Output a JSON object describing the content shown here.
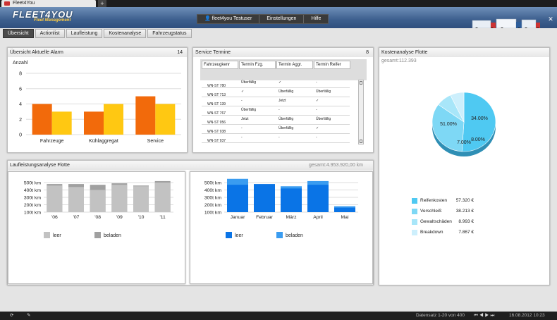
{
  "browser": {
    "tab_title": "Fleet4You",
    "new_tab": "+"
  },
  "header": {
    "logo_main": "FLEET4YOU",
    "logo_sub": "Fleet Management",
    "nav": [
      "fleet4you Testuser",
      "Einstellungen",
      "Hilfe"
    ],
    "close": "✕"
  },
  "tabs": [
    "Übersicht",
    "Actionlist",
    "Laufleistung",
    "Kostenanalyse",
    "Fahrzeugstatus"
  ],
  "alarm": {
    "title": "Übersicht Aktuelle Alarm",
    "count": "14",
    "ylabel": "Anzahl",
    "yticks": [
      "8",
      "6",
      "4",
      "2",
      "0"
    ]
  },
  "service": {
    "title": "Service Termine",
    "count": "8",
    "headers": [
      "Fahrzeugkenr",
      "Termin Fzg.",
      "Termin Aggr.",
      "Termin Reifer"
    ],
    "rows": [
      [
        "WN-ST 780",
        "Überfällig",
        "✓",
        "-"
      ],
      [
        "WN-ST 713",
        "✓",
        "Überfällig",
        "Überfällig"
      ],
      [
        "WN-ST 139",
        "-",
        "Jetzt",
        "✓"
      ],
      [
        "WN-ST 767",
        "Überfällig",
        "-",
        "-"
      ],
      [
        "WN-ST 956",
        "Jetzt",
        "Überfällig",
        "Überfällig"
      ],
      [
        "WN-ST 938",
        "-",
        "Überfällig",
        "✓"
      ],
      [
        "WN-ST 937",
        "-",
        "-",
        "-"
      ]
    ]
  },
  "kosten": {
    "title": "Kostenanalyse Flotte",
    "total": "gesamt:112.393",
    "slice_labels": [
      "51.00%",
      "34.00%",
      "8.00%",
      "7.00%"
    ],
    "legend": [
      {
        "name": "Reifenkosten",
        "value": "57.320 €"
      },
      {
        "name": "Verschleiß",
        "value": "38.213 €"
      },
      {
        "name": "Gewaltschäden",
        "value": "8.993 €"
      },
      {
        "name": "Breakdown",
        "value": "7.867 €"
      }
    ]
  },
  "lauf": {
    "title": "Laufleistungsanalyse Flotte",
    "total": "gesamt:4.953.920,00  km",
    "yticks": [
      "500t km",
      "400t km",
      "300t km",
      "200t km",
      "100t km"
    ],
    "legend": [
      "leer",
      "beladen"
    ]
  },
  "status": {
    "records": "Datensatz 1-20 von 400",
    "datetime": "16.08.2012 10:23"
  },
  "chart_data": [
    {
      "type": "bar",
      "title": "Übersicht Aktuelle Alarm",
      "ylabel": "Anzahl",
      "ylim": [
        0,
        8
      ],
      "categories": [
        "Fahrzeuge",
        "Kühlaggregat",
        "Service"
      ],
      "series": [
        {
          "values": [
            4,
            3,
            5
          ]
        },
        {
          "values": [
            3,
            4,
            4
          ]
        }
      ],
      "colors": [
        "#f26a0b",
        "#ffc812"
      ],
      "grid": true
    },
    {
      "type": "bar",
      "title": "Laufleistungsanalyse Flotte",
      "ylim": [
        100,
        500
      ],
      "categories": [
        "'06",
        "'07",
        "'08",
        "'09",
        "'10",
        "'11"
      ],
      "series": [
        {
          "name": "leer",
          "values": [
            460,
            440,
            400,
            470,
            450,
            500
          ]
        },
        {
          "name": "beladen",
          "values": [
            480,
            480,
            470,
            490,
            460,
            520
          ]
        }
      ],
      "colors": [
        "#c2c2c2",
        "#a0a0a0"
      ],
      "grid": true
    },
    {
      "type": "bar",
      "ylim": [
        100,
        500
      ],
      "categories": [
        "Januar",
        "Februar",
        "März",
        "April",
        "Mai"
      ],
      "series": [
        {
          "name": "leer",
          "values": [
            470,
            480,
            420,
            470,
            160
          ]
        },
        {
          "name": "beladen",
          "values": [
            550,
            460,
            450,
            520,
            180
          ]
        }
      ],
      "colors": [
        "#0a74e6",
        "#3a9cf0"
      ],
      "grid": true
    },
    {
      "type": "pie",
      "title": "Kostenanalyse Flotte",
      "categories": [
        "Reifenkosten",
        "Verschleiß",
        "Gewaltschäden",
        "Breakdown"
      ],
      "values": [
        51,
        34,
        8,
        7
      ],
      "colors": [
        "#4fc9f2",
        "#7ed8f5",
        "#a8e6f9",
        "#cdeffc"
      ]
    }
  ]
}
